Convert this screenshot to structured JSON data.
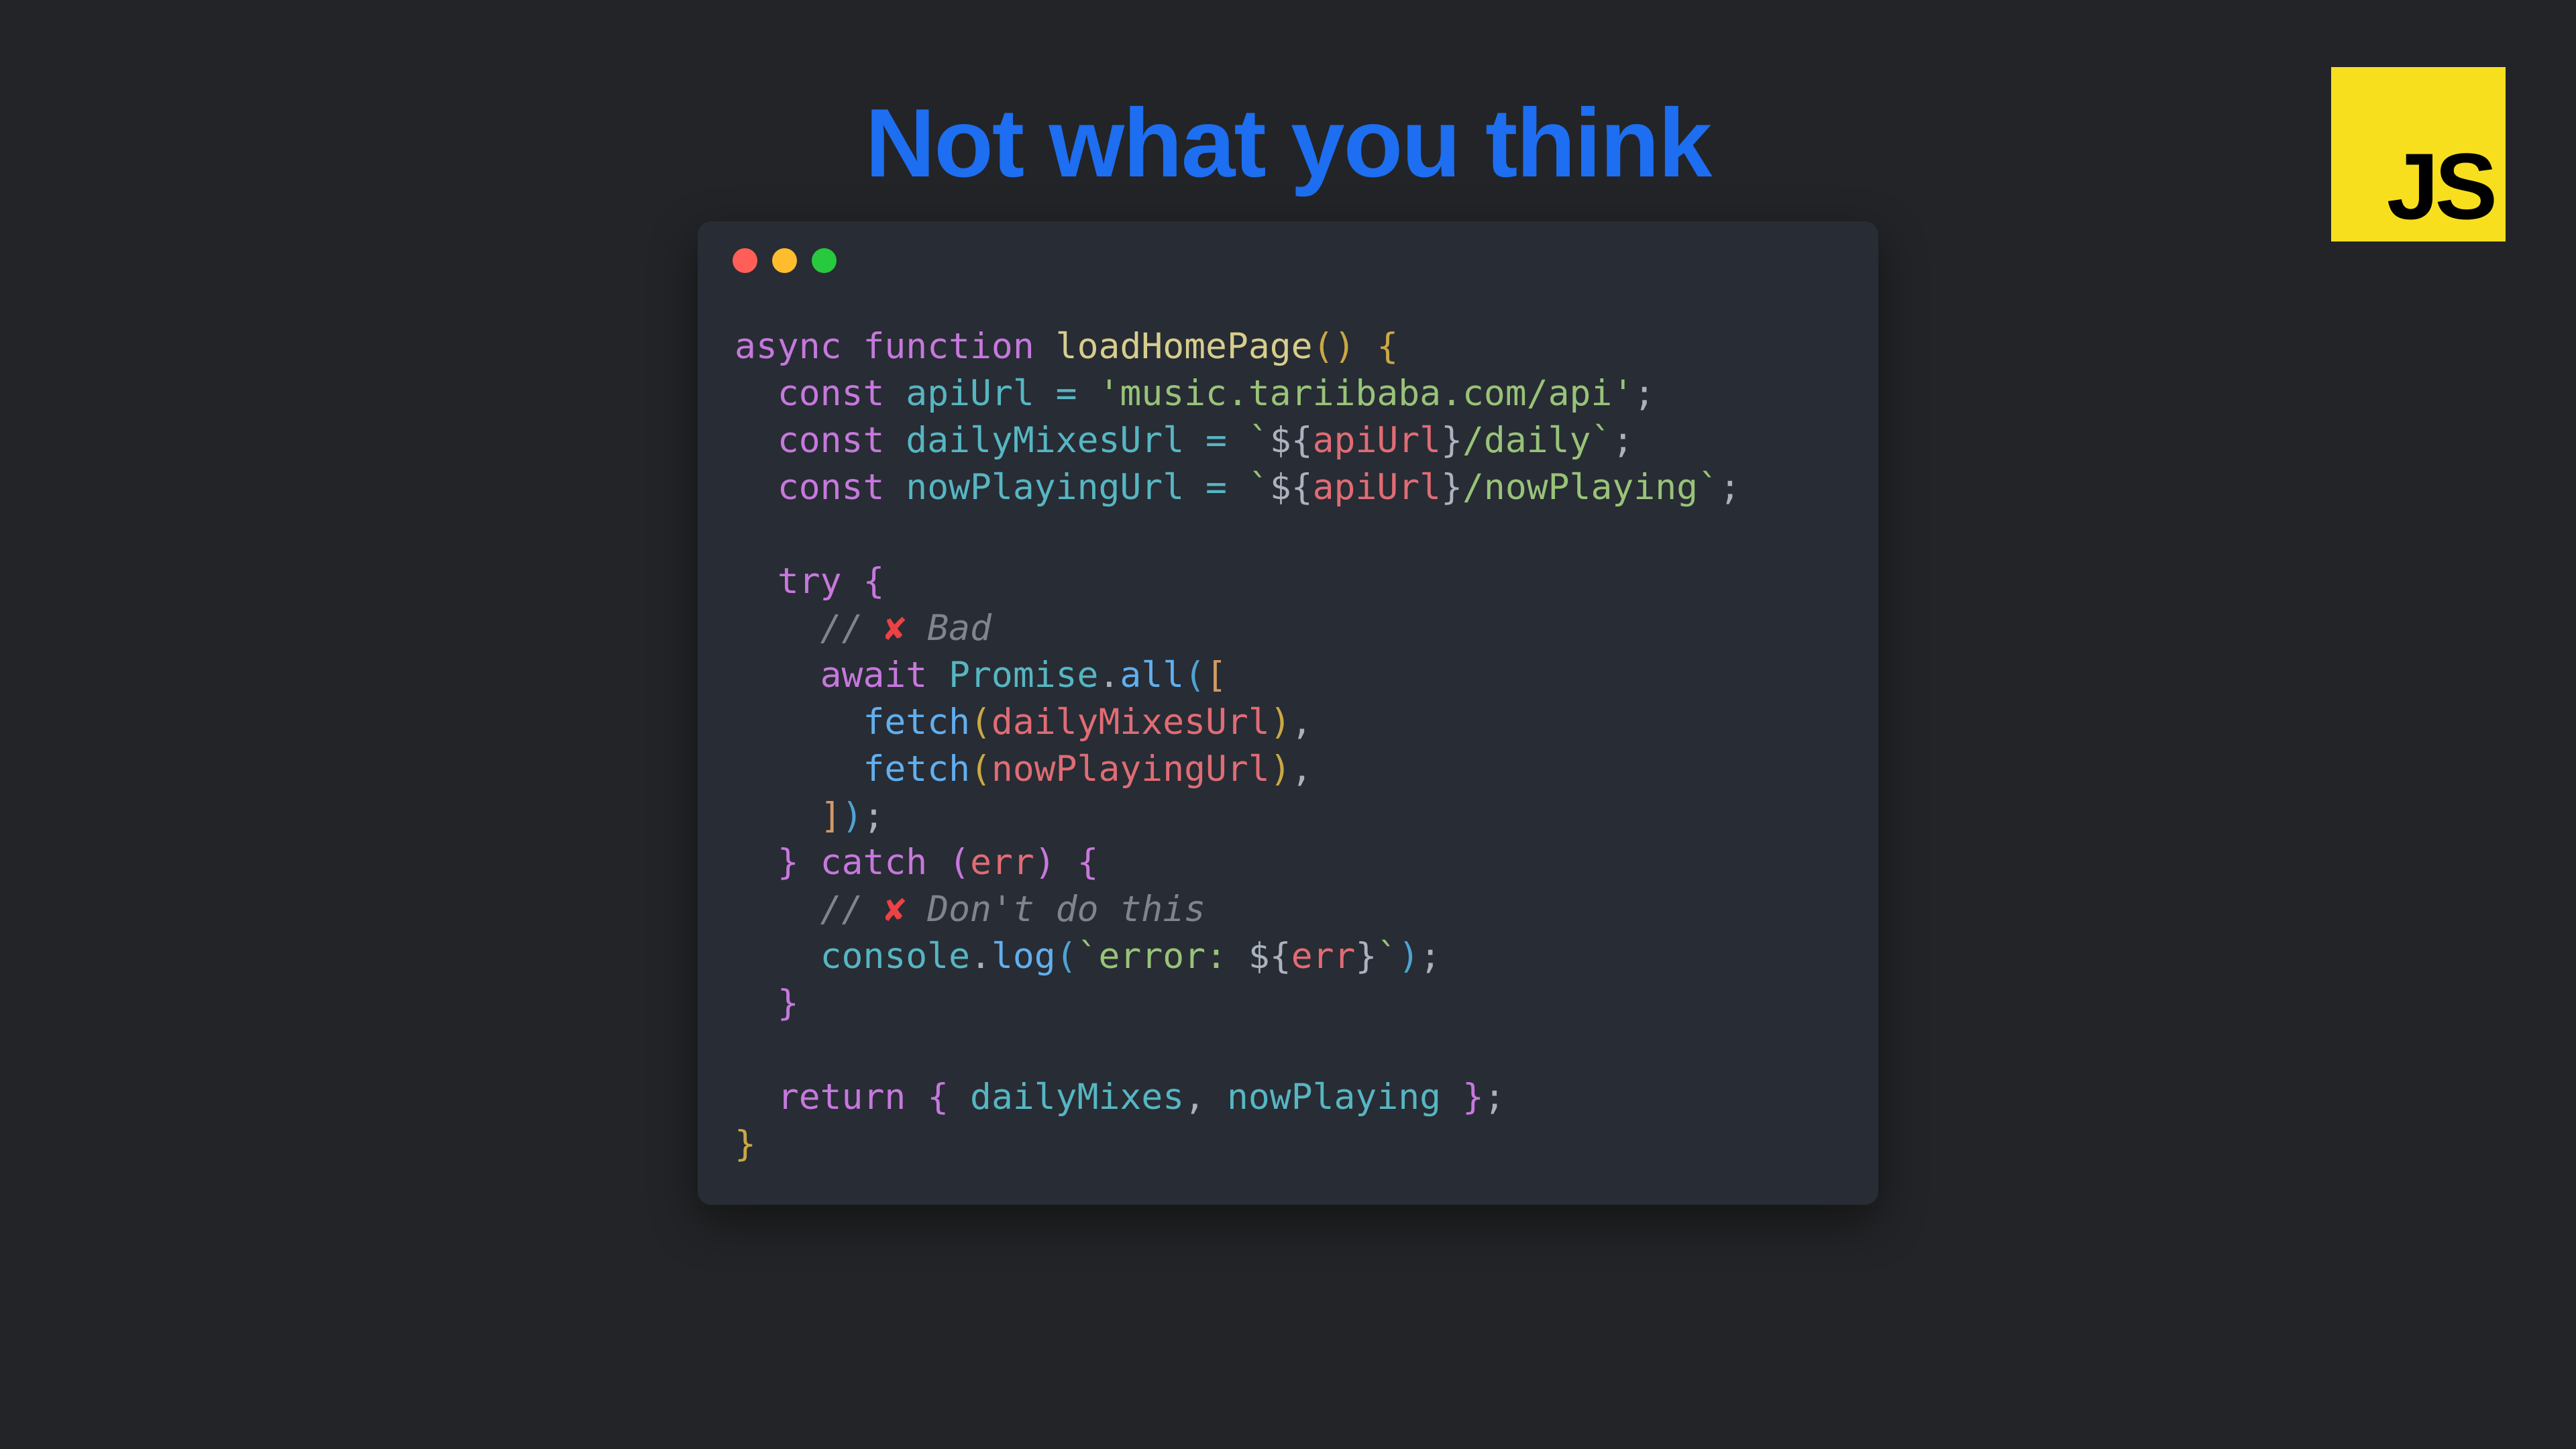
{
  "title": "Not what you think",
  "badge": {
    "label": "JS"
  },
  "colors": {
    "background": "#232427",
    "title": "#1D6EF0",
    "badgeBg": "#F7DF1E",
    "windowBg": "#282C34"
  },
  "window": {
    "trafficLights": [
      "red",
      "yellow",
      "green"
    ]
  },
  "code": {
    "lines": [
      {
        "i": "",
        "t": [
          {
            "c": "tk-kw",
            "v": "async"
          },
          {
            "c": "tk-punct",
            "v": " "
          },
          {
            "c": "tk-kw",
            "v": "function"
          },
          {
            "c": "tk-punct",
            "v": " "
          },
          {
            "c": "tk-fndef",
            "v": "loadHomePage"
          },
          {
            "c": "tk-paren-y",
            "v": "()"
          },
          {
            "c": "tk-punct",
            "v": " "
          },
          {
            "c": "tk-brace",
            "v": "{"
          }
        ]
      },
      {
        "i": "  ",
        "t": [
          {
            "c": "tk-kw",
            "v": "const"
          },
          {
            "c": "tk-punct",
            "v": " "
          },
          {
            "c": "tk-varsp",
            "v": "apiUrl"
          },
          {
            "c": "tk-punct",
            "v": " "
          },
          {
            "c": "tk-op",
            "v": "="
          },
          {
            "c": "tk-punct",
            "v": " "
          },
          {
            "c": "tk-str",
            "v": "'music.tariibaba.com/api'"
          },
          {
            "c": "tk-punct",
            "v": ";"
          }
        ]
      },
      {
        "i": "  ",
        "t": [
          {
            "c": "tk-kw",
            "v": "const"
          },
          {
            "c": "tk-punct",
            "v": " "
          },
          {
            "c": "tk-varsp",
            "v": "dailyMixesUrl"
          },
          {
            "c": "tk-punct",
            "v": " "
          },
          {
            "c": "tk-op",
            "v": "="
          },
          {
            "c": "tk-punct",
            "v": " "
          },
          {
            "c": "tk-tmpl",
            "v": "`"
          },
          {
            "c": "tk-punct",
            "v": "${"
          },
          {
            "c": "tk-var",
            "v": "apiUrl"
          },
          {
            "c": "tk-punct",
            "v": "}"
          },
          {
            "c": "tk-tmpl",
            "v": "/daily`"
          },
          {
            "c": "tk-punct",
            "v": ";"
          }
        ]
      },
      {
        "i": "  ",
        "t": [
          {
            "c": "tk-kw",
            "v": "const"
          },
          {
            "c": "tk-punct",
            "v": " "
          },
          {
            "c": "tk-varsp",
            "v": "nowPlayingUrl"
          },
          {
            "c": "tk-punct",
            "v": " "
          },
          {
            "c": "tk-op",
            "v": "="
          },
          {
            "c": "tk-punct",
            "v": " "
          },
          {
            "c": "tk-tmpl",
            "v": "`"
          },
          {
            "c": "tk-punct",
            "v": "${"
          },
          {
            "c": "tk-var",
            "v": "apiUrl"
          },
          {
            "c": "tk-punct",
            "v": "}"
          },
          {
            "c": "tk-tmpl",
            "v": "/nowPlaying`"
          },
          {
            "c": "tk-punct",
            "v": ";"
          }
        ]
      },
      {
        "i": "",
        "t": []
      },
      {
        "i": "  ",
        "t": [
          {
            "c": "tk-kw",
            "v": "try"
          },
          {
            "c": "tk-punct",
            "v": " "
          },
          {
            "c": "tk-paren-p",
            "v": "{"
          }
        ]
      },
      {
        "i": "    ",
        "t": [
          {
            "c": "tk-cmt",
            "v": "// "
          },
          {
            "c": "cross",
            "v": "✘"
          },
          {
            "c": "tk-cmt",
            "v": " Bad"
          }
        ]
      },
      {
        "i": "    ",
        "t": [
          {
            "c": "tk-kw",
            "v": "await"
          },
          {
            "c": "tk-punct",
            "v": " "
          },
          {
            "c": "tk-varsp",
            "v": "Promise"
          },
          {
            "c": "tk-punct",
            "v": "."
          },
          {
            "c": "tk-fn",
            "v": "all"
          },
          {
            "c": "tk-paren-b",
            "v": "("
          },
          {
            "c": "tk-brkt",
            "v": "["
          }
        ]
      },
      {
        "i": "      ",
        "t": [
          {
            "c": "tk-fn",
            "v": "fetch"
          },
          {
            "c": "tk-paren-y",
            "v": "("
          },
          {
            "c": "tk-var",
            "v": "dailyMixesUrl"
          },
          {
            "c": "tk-paren-y",
            "v": ")"
          },
          {
            "c": "tk-punct",
            "v": ","
          }
        ]
      },
      {
        "i": "      ",
        "t": [
          {
            "c": "tk-fn",
            "v": "fetch"
          },
          {
            "c": "tk-paren-y",
            "v": "("
          },
          {
            "c": "tk-var",
            "v": "nowPlayingUrl"
          },
          {
            "c": "tk-paren-y",
            "v": ")"
          },
          {
            "c": "tk-punct",
            "v": ","
          }
        ]
      },
      {
        "i": "    ",
        "t": [
          {
            "c": "tk-brkt",
            "v": "]"
          },
          {
            "c": "tk-paren-b",
            "v": ")"
          },
          {
            "c": "tk-punct",
            "v": ";"
          }
        ]
      },
      {
        "i": "  ",
        "t": [
          {
            "c": "tk-paren-p",
            "v": "}"
          },
          {
            "c": "tk-punct",
            "v": " "
          },
          {
            "c": "tk-kw",
            "v": "catch"
          },
          {
            "c": "tk-punct",
            "v": " "
          },
          {
            "c": "tk-paren-p",
            "v": "("
          },
          {
            "c": "tk-var",
            "v": "err"
          },
          {
            "c": "tk-paren-p",
            "v": ")"
          },
          {
            "c": "tk-punct",
            "v": " "
          },
          {
            "c": "tk-paren-p",
            "v": "{"
          }
        ]
      },
      {
        "i": "    ",
        "t": [
          {
            "c": "tk-cmt",
            "v": "// "
          },
          {
            "c": "cross",
            "v": "✘"
          },
          {
            "c": "tk-cmt",
            "v": " Don't do this"
          }
        ]
      },
      {
        "i": "    ",
        "t": [
          {
            "c": "tk-varsp",
            "v": "console"
          },
          {
            "c": "tk-punct",
            "v": "."
          },
          {
            "c": "tk-fn",
            "v": "log"
          },
          {
            "c": "tk-paren-b",
            "v": "("
          },
          {
            "c": "tk-tmpl",
            "v": "`error: "
          },
          {
            "c": "tk-punct",
            "v": "${"
          },
          {
            "c": "tk-var",
            "v": "err"
          },
          {
            "c": "tk-punct",
            "v": "}"
          },
          {
            "c": "tk-tmpl",
            "v": "`"
          },
          {
            "c": "tk-paren-b",
            "v": ")"
          },
          {
            "c": "tk-punct",
            "v": ";"
          }
        ]
      },
      {
        "i": "  ",
        "t": [
          {
            "c": "tk-paren-p",
            "v": "}"
          }
        ]
      },
      {
        "i": "",
        "t": []
      },
      {
        "i": "  ",
        "t": [
          {
            "c": "tk-kw",
            "v": "return"
          },
          {
            "c": "tk-punct",
            "v": " "
          },
          {
            "c": "tk-paren-p",
            "v": "{"
          },
          {
            "c": "tk-punct",
            "v": " "
          },
          {
            "c": "tk-varsp",
            "v": "dailyMixes"
          },
          {
            "c": "tk-punct",
            "v": ", "
          },
          {
            "c": "tk-varsp",
            "v": "nowPlaying"
          },
          {
            "c": "tk-punct",
            "v": " "
          },
          {
            "c": "tk-paren-p",
            "v": "}"
          },
          {
            "c": "tk-punct",
            "v": ";"
          }
        ]
      },
      {
        "i": "",
        "t": [
          {
            "c": "tk-brace",
            "v": "}"
          }
        ]
      }
    ]
  }
}
